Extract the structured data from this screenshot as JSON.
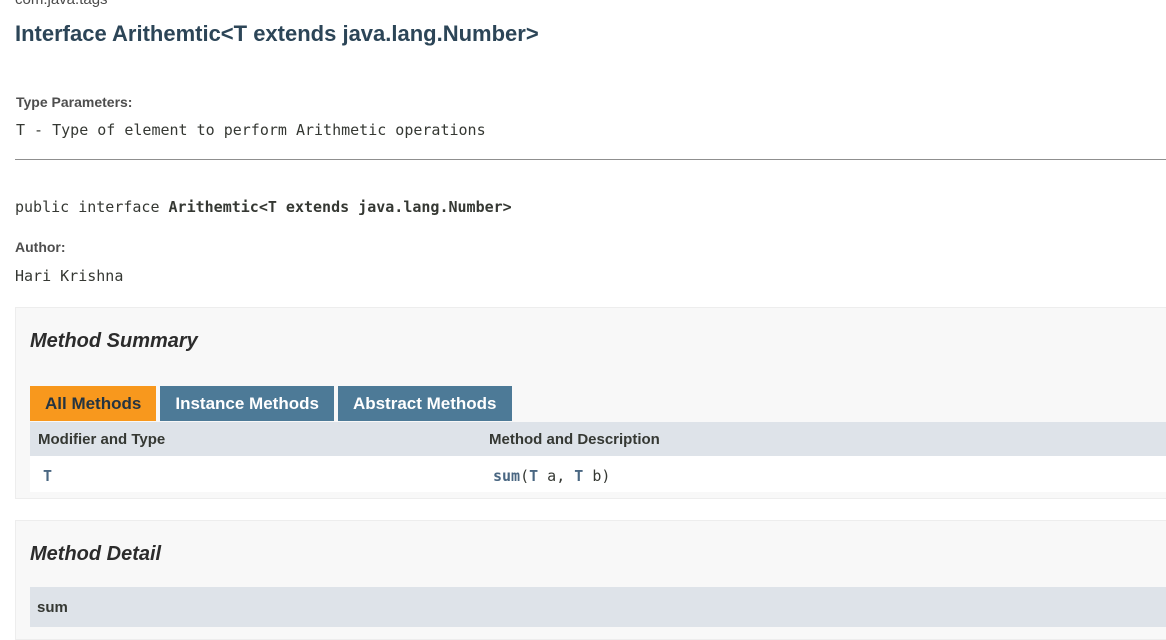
{
  "header": {
    "package_name": "com.java.tags",
    "title": "Interface Arithemtic<T extends java.lang.Number>"
  },
  "type_parameters": {
    "label": "Type Parameters:",
    "value": "T - Type of element to perform Arithmetic operations"
  },
  "signature": {
    "prefix": "public interface ",
    "name": "Arithemtic<T extends java.lang.Number>"
  },
  "author": {
    "label": "Author:",
    "value": "Hari Krishna"
  },
  "method_summary": {
    "title": "Method Summary",
    "tabs": [
      {
        "label": "All Methods",
        "active": true
      },
      {
        "label": "Instance Methods",
        "active": false
      },
      {
        "label": "Abstract Methods",
        "active": false
      }
    ],
    "columns": [
      "Modifier and Type",
      "Method and Description"
    ],
    "rows": [
      {
        "modifier": "T",
        "method_name": "sum",
        "params_open": "(",
        "param1_type": "T",
        "param1_name": " a, ",
        "param2_type": "T",
        "param2_name": " b)"
      }
    ]
  },
  "method_detail": {
    "title": "Method Detail",
    "first_method": "sum"
  },
  "colors": {
    "active_tab": "#f8981d",
    "inactive_tab": "#4d7a97",
    "table_header": "#dee3e9",
    "link": "#4a6782"
  }
}
